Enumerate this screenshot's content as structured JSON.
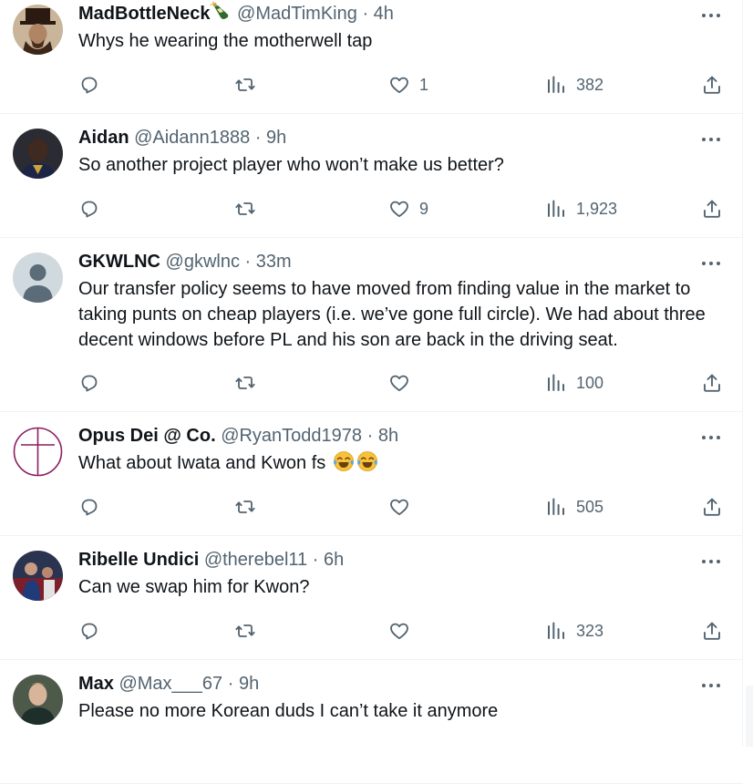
{
  "tweets": [
    {
      "name": "MadBottleNeck",
      "handle": "@MadTimKing",
      "dot": "·",
      "time": "4h",
      "text": "Whys he wearing the motherwell tap",
      "replies": "",
      "retweets": "",
      "likes": "1",
      "views": "382"
    },
    {
      "name": "Aidan",
      "handle": "@Aidann1888",
      "dot": "·",
      "time": "9h",
      "text": "So another project player who won’t make us better?",
      "replies": "",
      "retweets": "",
      "likes": "9",
      "views": "1,923"
    },
    {
      "name": "GKWLNC",
      "handle": "@gkwlnc",
      "dot": "·",
      "time": "33m",
      "text": "Our transfer policy seems to have moved from finding value in the market to taking punts on cheap players (i.e. we’ve gone full circle). We had about three decent windows before PL and his son are back in the driving seat.",
      "replies": "",
      "retweets": "",
      "likes": "",
      "views": "100"
    },
    {
      "name": "Opus Dei @ Co.",
      "handle": "@RyanTodd1978",
      "dot": "·",
      "time": "8h",
      "text": "What about Iwata and Kwon fs",
      "replies": "",
      "retweets": "",
      "likes": "",
      "views": "505"
    },
    {
      "name": "Ribelle Undici",
      "handle": "@therebel11",
      "dot": "·",
      "time": "6h",
      "text": "Can we swap him for Kwon?",
      "replies": "",
      "retweets": "",
      "likes": "",
      "views": "323"
    },
    {
      "name": "Max",
      "handle": "@Max___67",
      "dot": "·",
      "time": "9h",
      "text": "Please no more Korean duds I can’t take it anymore",
      "replies": "",
      "retweets": "",
      "likes": "",
      "views": ""
    }
  ],
  "icons": {
    "reply": "reply-icon",
    "retweet": "retweet-icon",
    "like": "heart-icon",
    "views": "views-chart-icon",
    "share": "share-icon",
    "more": "more-dots-icon",
    "emoji": "tears-of-joy-emoji",
    "bottle": "champagne-bottle-emoji"
  },
  "colors": {
    "text": "#0f1419",
    "secondary": "#536471",
    "divider": "#eff3f4",
    "cross": "#8b1e5f"
  }
}
